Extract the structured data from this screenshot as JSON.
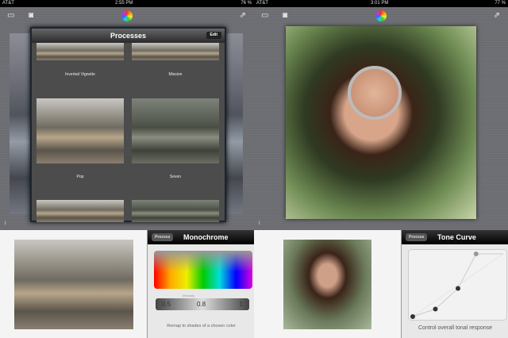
{
  "left_screen": {
    "status": {
      "carrier": "AT&T",
      "time": "2:55 PM",
      "battery": "76 %"
    },
    "toolbar": {
      "icons": [
        "layers-icon",
        "camera-icon",
        "color-wheel-icon",
        "share-icon"
      ]
    },
    "popover": {
      "title": "Processes",
      "edit_label": "Edit",
      "items": [
        {
          "label": "Inverted Vignette"
        },
        {
          "label": "Mission"
        },
        {
          "label": "Pop"
        },
        {
          "label": "Seven"
        }
      ]
    },
    "info_icon": "i"
  },
  "right_screen": {
    "status": {
      "carrier": "AT&T",
      "time": "3:01 PM",
      "battery": "77 %"
    },
    "toolbar": {
      "icons": [
        "layers-icon",
        "camera-icon",
        "color-wheel-icon",
        "share-icon"
      ]
    },
    "info_icon": "i"
  },
  "monochrome_panel": {
    "process_label": "Process",
    "title": "Monochrome",
    "slider_label": "Intensity",
    "slider_min": "0.5",
    "slider_value": "0.8",
    "slider_max": "1",
    "description": "Remap to shades of a chosen color"
  },
  "tone_panel": {
    "process_label": "Process",
    "title": "Tone Curve",
    "description": "Control overall tonal response",
    "curve_points": [
      [
        0,
        0
      ],
      [
        0.25,
        0.12
      ],
      [
        0.5,
        0.45
      ],
      [
        0.7,
        1
      ],
      [
        1,
        1
      ]
    ]
  }
}
